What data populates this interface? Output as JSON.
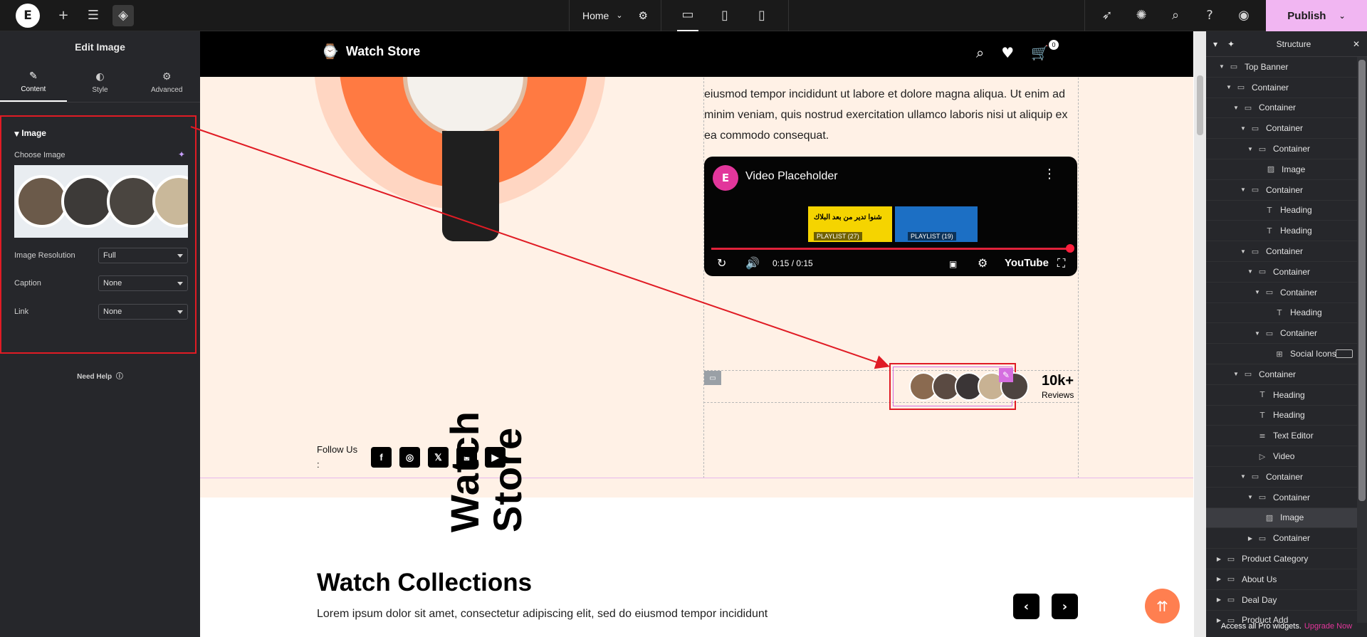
{
  "topbar": {
    "page": "Home",
    "publish": "Publish"
  },
  "left_panel": {
    "title": "Edit Image",
    "tabs": [
      {
        "label": "Content",
        "icon": "pencil-icon"
      },
      {
        "label": "Style",
        "icon": "contrast-icon"
      },
      {
        "label": "Advanced",
        "icon": "gear-icon"
      }
    ],
    "section": "Image",
    "choose_image": "Choose Image",
    "fields": [
      {
        "label": "Image Resolution",
        "value": "Full"
      },
      {
        "label": "Caption",
        "value": "None"
      },
      {
        "label": "Link",
        "value": "None"
      }
    ],
    "help": "Need Help"
  },
  "site": {
    "brand": "Watch Store",
    "cart_count": "0",
    "hero_text": "eiusmod tempor incididunt ut labore et dolore magna aliqua. Ut enim ad minim veniam, quis nostrud exercitation ullamco laboris nisi ut aliquip ex ea commodo consequat.",
    "video": {
      "title": "Video Placeholder",
      "thumb1_text": "شنوا تدير من بعد البلاك",
      "playlist1": "PLAYLIST (27)",
      "playlist2": "PLAYLIST (19)",
      "time": "0:15 / 0:15",
      "brand": "YouTube",
      "progress_fraction": 1.0
    },
    "reviews_count": "10k+",
    "reviews_label": "Reviews",
    "follow_label": "Follow Us :",
    "socials": [
      "f",
      "◎",
      "𝕏",
      "◙",
      "▶"
    ],
    "vertical_brand_line1": "Watch",
    "vertical_brand_line2": "Store",
    "collections_title": "Watch Collections",
    "collections_sub": "Lorem ipsum dolor sit amet, consectetur adipiscing elit, sed do eiusmod tempor incididunt"
  },
  "structure": {
    "title": "Structure",
    "items": [
      {
        "label": "Top Banner",
        "type": "container",
        "arrow": "down"
      },
      {
        "label": "Container",
        "type": "container",
        "arrow": "down"
      },
      {
        "label": "Container",
        "type": "container",
        "arrow": "down"
      },
      {
        "label": "Container",
        "type": "container",
        "arrow": "down"
      },
      {
        "label": "Container",
        "type": "container",
        "arrow": "down"
      },
      {
        "label": "Image",
        "type": "image",
        "arrow": ""
      },
      {
        "label": "Container",
        "type": "container",
        "arrow": "down"
      },
      {
        "label": "Heading",
        "type": "heading",
        "arrow": ""
      },
      {
        "label": "Heading",
        "type": "heading",
        "arrow": ""
      },
      {
        "label": "Container",
        "type": "container",
        "arrow": "down"
      },
      {
        "label": "Container",
        "type": "container",
        "arrow": "down"
      },
      {
        "label": "Container",
        "type": "container",
        "arrow": "down"
      },
      {
        "label": "Heading",
        "type": "heading",
        "arrow": ""
      },
      {
        "label": "Container",
        "type": "container",
        "arrow": "down"
      },
      {
        "label": "Social Icons",
        "type": "social",
        "arrow": ""
      },
      {
        "label": "Container",
        "type": "container",
        "arrow": "down"
      },
      {
        "label": "Heading",
        "type": "heading",
        "arrow": ""
      },
      {
        "label": "Heading",
        "type": "heading",
        "arrow": ""
      },
      {
        "label": "Text Editor",
        "type": "text",
        "arrow": ""
      },
      {
        "label": "Video",
        "type": "video",
        "arrow": ""
      },
      {
        "label": "Container",
        "type": "container",
        "arrow": "down"
      },
      {
        "label": "Container",
        "type": "container",
        "arrow": "down"
      },
      {
        "label": "Image",
        "type": "image",
        "arrow": "",
        "selected": true
      },
      {
        "label": "Container",
        "type": "container",
        "arrow": "right"
      },
      {
        "label": "Product Category",
        "type": "container",
        "arrow": "right"
      },
      {
        "label": "About Us",
        "type": "container",
        "arrow": "right"
      },
      {
        "label": "Deal Day",
        "type": "container",
        "arrow": "right"
      },
      {
        "label": "Product Add",
        "type": "container",
        "arrow": "right"
      }
    ],
    "footer_text": "Access all Pro widgets.",
    "footer_link": "Upgrade Now"
  },
  "colors": {
    "accent": "#e2369b",
    "highlight": "#e01b24",
    "publish": "#f1b6f2",
    "hero_bg": "#fff1e6",
    "watch_orange": "#ff7a42"
  }
}
